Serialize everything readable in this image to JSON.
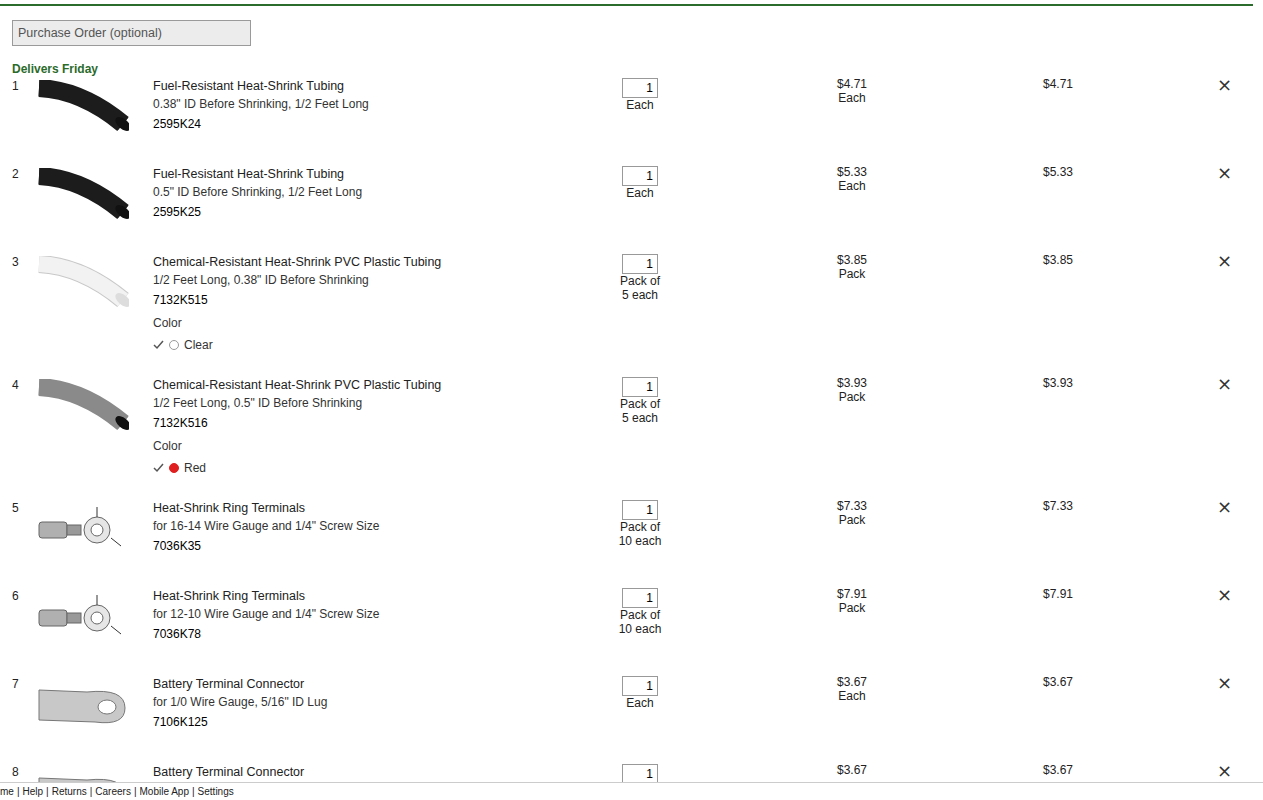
{
  "purchase_order": {
    "placeholder": "Purchase Order (optional)"
  },
  "delivery": {
    "label": "Delivers Friday"
  },
  "remove_glyph": "×",
  "rows": [
    {
      "number": "1",
      "image_kind": "tube",
      "image_color": "#1c1c1c",
      "title": "Fuel-Resistant Heat-Shrink Tubing",
      "detail": "0.38\" ID Before Shrinking, 1/2 Feet Long",
      "sku": "2595K24",
      "qty": "1",
      "unit": [
        "Each"
      ],
      "price": "$4.71",
      "price_unit": "Each",
      "total": "$4.71"
    },
    {
      "number": "2",
      "image_kind": "tube",
      "image_color": "#1c1c1c",
      "title": "Fuel-Resistant Heat-Shrink Tubing",
      "detail": "0.5\" ID Before Shrinking, 1/2 Feet Long",
      "sku": "2595K25",
      "qty": "1",
      "unit": [
        "Each"
      ],
      "price": "$5.33",
      "price_unit": "Each",
      "total": "$5.33"
    },
    {
      "number": "3",
      "image_kind": "tube",
      "image_color": "#f2f2f2",
      "title": "Chemical-Resistant Heat-Shrink PVC Plastic Tubing",
      "detail": "1/2 Feet Long, 0.38\" ID Before Shrinking",
      "sku": "7132K515",
      "qty": "1",
      "unit": [
        "Pack of",
        "5 each"
      ],
      "price": "$3.85",
      "price_unit": "Pack",
      "total": "$3.85",
      "option": {
        "label": "Color",
        "value": "Clear",
        "selected": true,
        "color": "#ffffff"
      }
    },
    {
      "number": "4",
      "image_kind": "tube",
      "image_color": "#8a8a8a",
      "title": "Chemical-Resistant Heat-Shrink PVC Plastic Tubing",
      "detail": "1/2 Feet Long, 0.5\" ID Before Shrinking",
      "sku": "7132K516",
      "qty": "1",
      "unit": [
        "Pack of",
        "5 each"
      ],
      "price": "$3.93",
      "price_unit": "Pack",
      "total": "$3.93",
      "option": {
        "label": "Color",
        "value": "Red",
        "selected": true,
        "color": "#e02020"
      }
    },
    {
      "number": "5",
      "image_kind": "ring",
      "image_color": "#b0b0b0",
      "title": "Heat-Shrink Ring Terminals",
      "detail": "for 16-14 Wire Gauge and 1/4\" Screw Size",
      "sku": "7036K35",
      "qty": "1",
      "unit": [
        "Pack of",
        "10 each"
      ],
      "price": "$7.33",
      "price_unit": "Pack",
      "total": "$7.33"
    },
    {
      "number": "6",
      "image_kind": "ring",
      "image_color": "#b0b0b0",
      "title": "Heat-Shrink Ring Terminals",
      "detail": "for 12-10 Wire Gauge and 1/4\" Screw Size",
      "sku": "7036K78",
      "qty": "1",
      "unit": [
        "Pack of",
        "10 each"
      ],
      "price": "$7.91",
      "price_unit": "Pack",
      "total": "$7.91"
    },
    {
      "number": "7",
      "image_kind": "lug",
      "image_color": "#c8c8c8",
      "title": "Battery Terminal Connector",
      "detail": "for 1/0 Wire Gauge, 5/16\" ID Lug",
      "sku": "7106K125",
      "qty": "1",
      "unit": [
        "Each"
      ],
      "price": "$3.67",
      "price_unit": "Each",
      "total": "$3.67"
    },
    {
      "number": "8",
      "image_kind": "lug",
      "image_color": "#c8c8c8",
      "title": "Battery Terminal Connector",
      "qty": "1",
      "price": "$3.67",
      "total": "$3.67"
    }
  ],
  "footer": {
    "links": [
      "me",
      "Help",
      "Returns",
      "Careers",
      "Mobile App",
      "Settings"
    ],
    "separator": "|"
  }
}
